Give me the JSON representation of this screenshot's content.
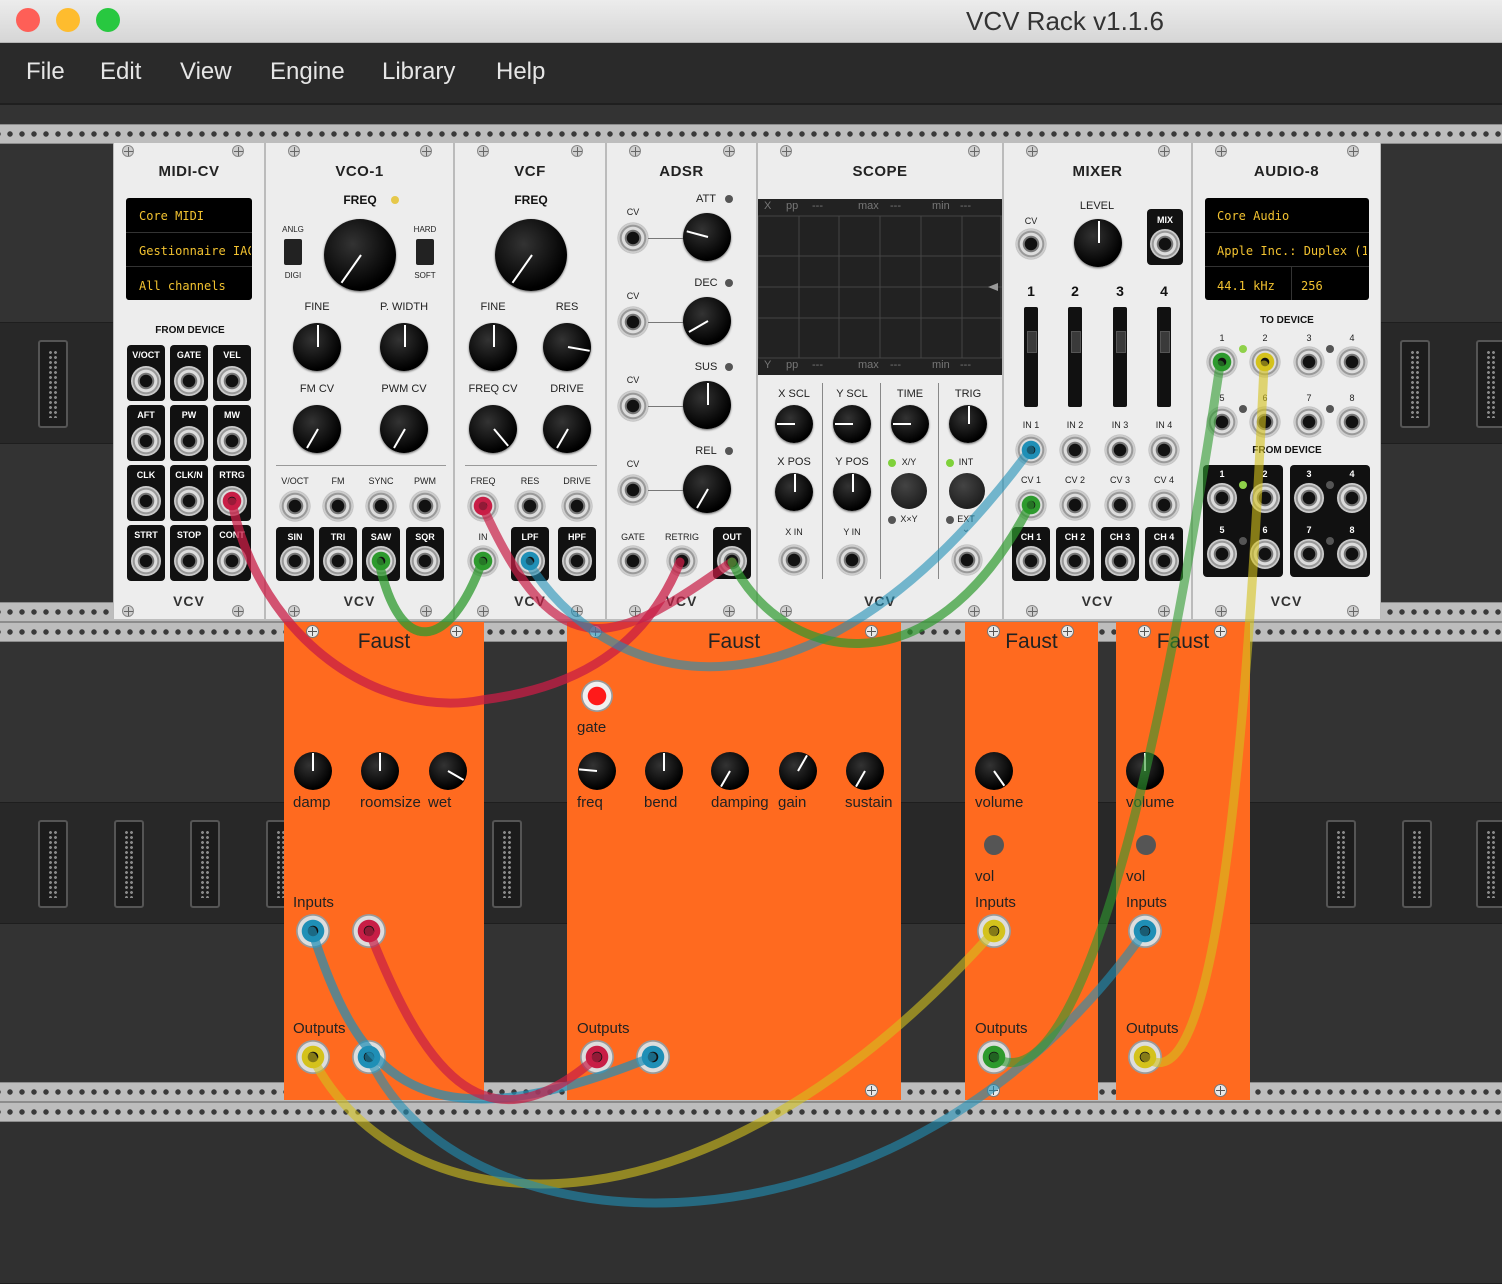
{
  "window": {
    "title": "VCV Rack v1.1.6",
    "colors": {
      "close": "#fe5f57",
      "minimize": "#febc2e",
      "zoom": "#28c840"
    }
  },
  "menu": [
    "File",
    "Edit",
    "View",
    "Engine",
    "Library",
    "Help"
  ],
  "midi_cv": {
    "title": "MIDI-CV",
    "driver": "Core MIDI",
    "device": "Gestionnaire IAC",
    "channel": "All channels",
    "section": "FROM DEVICE",
    "outputs": [
      "V/OCT",
      "GATE",
      "VEL",
      "AFT",
      "PW",
      "MW",
      "CLK",
      "CLK/N",
      "RTRG",
      "STRT",
      "STOP",
      "CONT"
    ],
    "brand": "VCV"
  },
  "vco": {
    "title": "VCO-1",
    "freq": "FREQ",
    "anlg": "ANLG",
    "digi": "DIGI",
    "hard": "HARD",
    "soft": "SOFT",
    "fine": "FINE",
    "pwidth": "P. WIDTH",
    "fmcv": "FM CV",
    "pwmcv": "PWM CV",
    "inputs": [
      "V/OCT",
      "FM",
      "SYNC",
      "PWM"
    ],
    "outputs": [
      "SIN",
      "TRI",
      "SAW",
      "SQR"
    ],
    "brand": "VCV"
  },
  "vcf": {
    "title": "VCF",
    "freq": "FREQ",
    "fine": "FINE",
    "res": "RES",
    "freqcv": "FREQ CV",
    "drive": "DRIVE",
    "inputs": [
      "FREQ",
      "RES",
      "DRIVE"
    ],
    "in": "IN",
    "outputs": [
      "LPF",
      "HPF"
    ],
    "brand": "VCV"
  },
  "adsr": {
    "title": "ADSR",
    "cv": "CV",
    "knobs": [
      "ATT",
      "DEC",
      "SUS",
      "REL"
    ],
    "gate": "GATE",
    "retrig": "RETRIG",
    "out": "OUT",
    "brand": "VCV"
  },
  "scope": {
    "title": "SCOPE",
    "top_row": [
      "X",
      "pp",
      "---",
      "max",
      "---",
      "min",
      "---"
    ],
    "bottom_row": [
      "Y",
      "pp",
      "---",
      "max",
      "---",
      "min",
      "---"
    ],
    "knobs": [
      "X SCL",
      "Y SCL",
      "TIME",
      "TRIG",
      "X POS",
      "Y POS"
    ],
    "xy": "X/Y",
    "xxy": "X×Y",
    "int": "INT",
    "ext": "EXT",
    "xin": "X IN",
    "yin": "Y IN",
    "brand": "VCV"
  },
  "mixer": {
    "title": "MIXER",
    "cv": "CV",
    "level": "LEVEL",
    "mix": "MIX",
    "channels": [
      "1",
      "2",
      "3",
      "4"
    ],
    "ins": [
      "IN 1",
      "IN 2",
      "IN 3",
      "IN 4"
    ],
    "cvs": [
      "CV 1",
      "CV 2",
      "CV 3",
      "CV 4"
    ],
    "outs": [
      "CH 1",
      "CH 2",
      "CH 3",
      "CH 4"
    ],
    "brand": "VCV"
  },
  "audio": {
    "title": "AUDIO-8",
    "driver": "Core Audio",
    "device": "Apple Inc.: Duplex (1-",
    "rate": "44.1 kHz",
    "block": "256",
    "to_device": "TO DEVICE",
    "from_device": "FROM DEVICE",
    "nums": [
      "1",
      "2",
      "3",
      "4",
      "5",
      "6",
      "7",
      "8"
    ],
    "brand": "VCV"
  },
  "faust1": {
    "title": "Faust",
    "knobs": [
      "damp",
      "roomsize",
      "wet"
    ],
    "inputs": "Inputs",
    "outputs": "Outputs"
  },
  "faust2": {
    "title": "Faust",
    "gate": "gate",
    "knobs": [
      "freq",
      "bend",
      "damping",
      "gain",
      "sustain"
    ],
    "outputs": "Outputs"
  },
  "faust3": {
    "title": "Faust",
    "knob": "volume",
    "vol": "vol",
    "inputs": "Inputs",
    "outputs": "Outputs"
  },
  "faust4": {
    "title": "Faust",
    "knob": "volume",
    "vol": "vol",
    "inputs": "Inputs",
    "outputs": "Outputs"
  },
  "colors": {
    "faust": "#ff6a1f",
    "panel": "#ededed",
    "cable_red": "#c81e46",
    "cable_green": "#2e9a2e",
    "cable_blue": "#1f8fb6",
    "cable_yellow": "#d4c21c"
  }
}
